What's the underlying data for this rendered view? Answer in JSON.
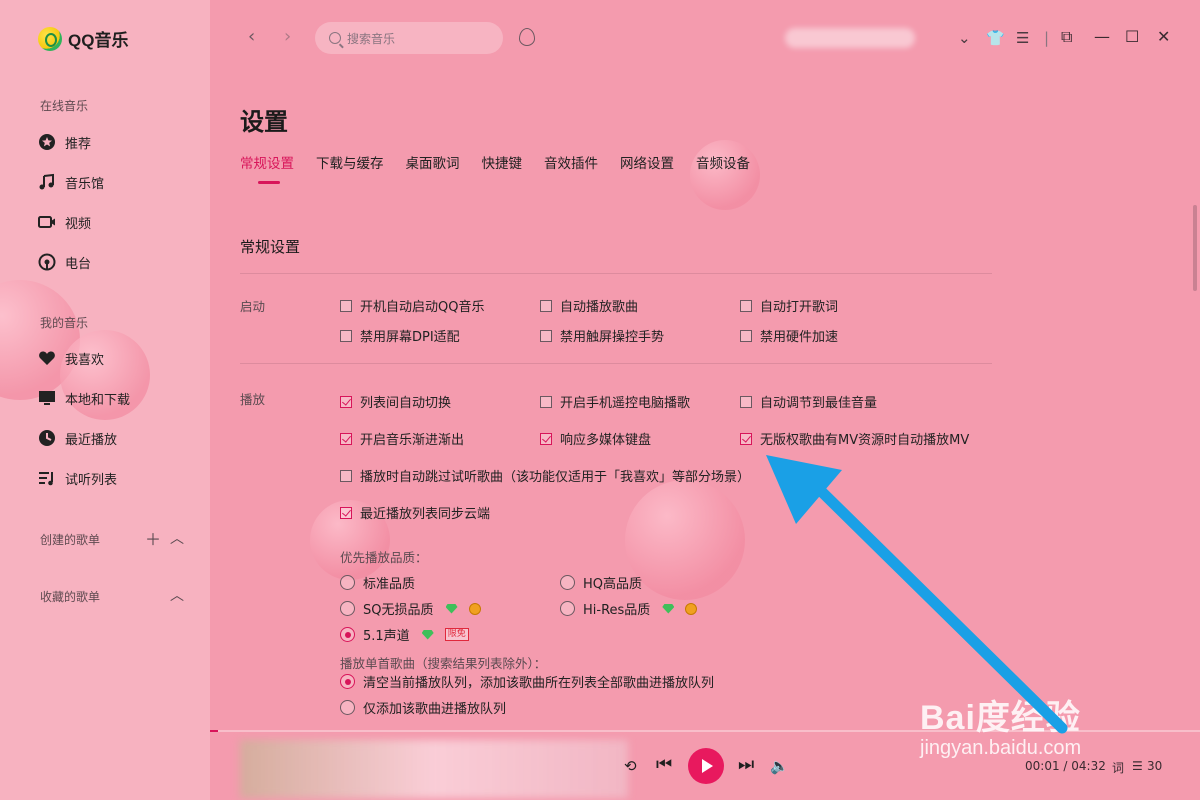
{
  "app": {
    "name": "QQ音乐"
  },
  "sidebar": {
    "online_section": "在线音乐",
    "online_items": [
      {
        "label": "推荐",
        "icon": "star-icon"
      },
      {
        "label": "音乐馆",
        "icon": "music-note-icon"
      },
      {
        "label": "视频",
        "icon": "video-icon"
      },
      {
        "label": "电台",
        "icon": "radio-icon"
      }
    ],
    "my_section": "我的音乐",
    "my_items": [
      {
        "label": "我喜欢",
        "icon": "heart-icon"
      },
      {
        "label": "本地和下载",
        "icon": "monitor-icon"
      },
      {
        "label": "最近播放",
        "icon": "clock-icon"
      },
      {
        "label": "试听列表",
        "icon": "playlist-icon"
      }
    ],
    "created_section": "创建的歌单",
    "collected_section": "收藏的歌单"
  },
  "topbar": {
    "search_placeholder": "搜索音乐"
  },
  "settings": {
    "title": "设置",
    "tabs": [
      "常规设置",
      "下载与缓存",
      "桌面歌词",
      "快捷键",
      "音效插件",
      "网络设置",
      "音频设备"
    ],
    "active_tab": "常规设置",
    "section_title": "常规设置",
    "startup": {
      "label": "启动",
      "options": [
        {
          "label": "开机自动启动QQ音乐",
          "checked": false
        },
        {
          "label": "自动播放歌曲",
          "checked": false
        },
        {
          "label": "自动打开歌词",
          "checked": false
        },
        {
          "label": "禁用屏幕DPI适配",
          "checked": false
        },
        {
          "label": "禁用触屏操控手势",
          "checked": false
        },
        {
          "label": "禁用硬件加速",
          "checked": false
        }
      ]
    },
    "playback": {
      "label": "播放",
      "options": [
        {
          "label": "列表间自动切换",
          "checked": true
        },
        {
          "label": "开启手机遥控电脑播歌",
          "checked": false
        },
        {
          "label": "自动调节到最佳音量",
          "checked": false
        },
        {
          "label": "开启音乐渐进渐出",
          "checked": true
        },
        {
          "label": "响应多媒体键盘",
          "checked": true
        },
        {
          "label": "无版权歌曲有MV资源时自动播放MV",
          "checked": true
        },
        {
          "label": "播放时自动跳过试听歌曲（该功能仅适用于「我喜欢」等部分场景）",
          "checked": false
        },
        {
          "label": "最近播放列表同步云端",
          "checked": true
        }
      ],
      "quality_label": "优先播放品质：",
      "quality_options": [
        {
          "label": "标准品质",
          "selected": false
        },
        {
          "label": "HQ高品质",
          "selected": false
        },
        {
          "label": "SQ无损品质",
          "selected": false
        },
        {
          "label": "Hi-Res品质",
          "selected": false
        },
        {
          "label": "5.1声道",
          "selected": true,
          "badge": "限免"
        }
      ],
      "single_label": "播放单首歌曲（搜索结果列表除外）：",
      "single_options": [
        {
          "label": "清空当前播放队列，添加该歌曲所在列表全部歌曲进播放队列",
          "selected": true
        },
        {
          "label": "仅添加该歌曲进播放队列",
          "selected": false
        }
      ]
    }
  },
  "player": {
    "time": "00:01 / 04:32",
    "lyrics_label": "词",
    "queue_count": "30"
  },
  "watermark": {
    "main": "Bai度经验",
    "sub": "jingyan.baidu.com"
  },
  "colors": {
    "accent": "#d8155a",
    "annotation_arrow": "#1aa0e6"
  }
}
